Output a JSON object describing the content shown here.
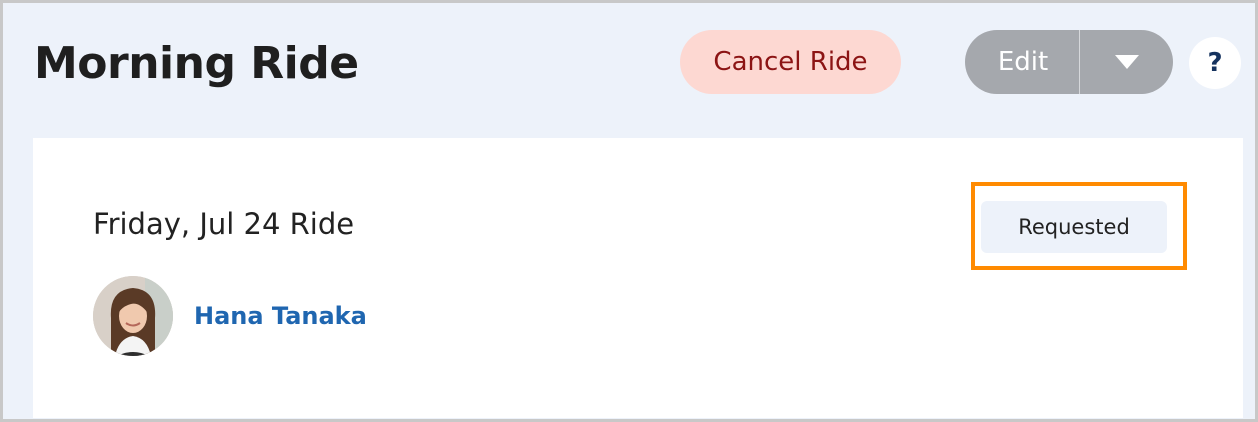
{
  "header": {
    "title": "Morning Ride",
    "cancel_label": "Cancel Ride",
    "edit_label": "Edit",
    "help_label": "?",
    "icons": {
      "dropdown": "caret-down-icon"
    }
  },
  "ride": {
    "date_label": "Friday, Jul 24 Ride",
    "status": "Requested",
    "rider": {
      "name": "Hana Tanaka",
      "avatar": "rider-photo"
    }
  },
  "colors": {
    "background": "#edf2fa",
    "cancel_bg": "#fdd8d2",
    "cancel_text": "#8c1414",
    "edit_bg": "#a5a8ad",
    "highlight": "#ff8a00",
    "link": "#1f66b0"
  }
}
